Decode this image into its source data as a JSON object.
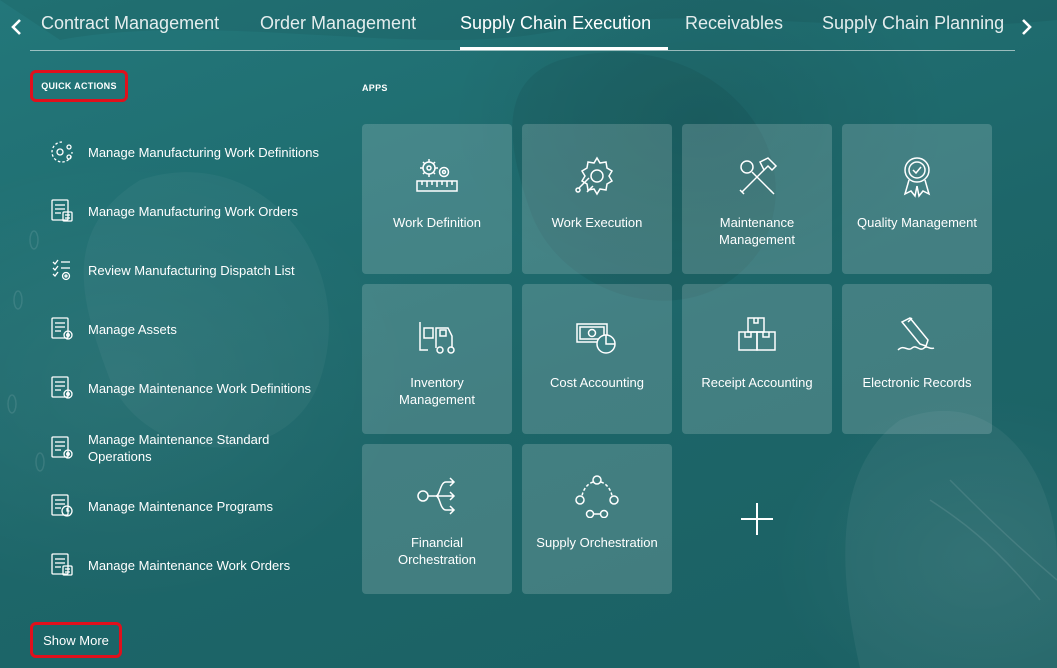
{
  "nav": {
    "tabs": [
      {
        "label": "Contract Management",
        "active": false
      },
      {
        "label": "Order Management",
        "active": false
      },
      {
        "label": "Supply Chain Execution",
        "active": true
      },
      {
        "label": "Receivables",
        "active": false
      },
      {
        "label": "Supply Chain Planning",
        "active": false
      }
    ],
    "left_arrow_icon": "chevron-left-icon",
    "right_arrow_icon": "chevron-right-icon"
  },
  "quick_actions": {
    "heading": "QUICK ACTIONS",
    "items": [
      {
        "label": "Manage Manufacturing Work Definitions",
        "icon": "work-definition-icon"
      },
      {
        "label": "Manage Manufacturing Work Orders",
        "icon": "work-order-icon"
      },
      {
        "label": "Review Manufacturing Dispatch List",
        "icon": "dispatch-list-icon"
      },
      {
        "label": "Manage Assets",
        "icon": "asset-list-icon"
      },
      {
        "label": "Manage Maintenance Work Definitions",
        "icon": "maintenance-definition-icon"
      },
      {
        "label": "Manage Maintenance Standard Operations",
        "icon": "standard-operations-icon"
      },
      {
        "label": "Manage Maintenance Programs",
        "icon": "maintenance-program-icon"
      },
      {
        "label": "Manage Maintenance Work Orders",
        "icon": "maintenance-work-order-icon"
      }
    ],
    "show_more": "Show More"
  },
  "apps": {
    "heading": "APPS",
    "tiles": [
      {
        "label": "Work Definition",
        "icon": "gears-ruler-icon"
      },
      {
        "label": "Work Execution",
        "icon": "gear-wrench-icon"
      },
      {
        "label": "Maintenance Management",
        "icon": "hammer-wrench-icon"
      },
      {
        "label": "Quality Management",
        "icon": "award-ribbon-icon"
      },
      {
        "label": "Inventory Management",
        "icon": "forklift-icon"
      },
      {
        "label": "Cost Accounting",
        "icon": "money-chart-icon"
      },
      {
        "label": "Receipt Accounting",
        "icon": "boxes-icon"
      },
      {
        "label": "Electronic Records",
        "icon": "signature-pen-icon"
      },
      {
        "label": "Financial Orchestration",
        "icon": "flow-arrows-icon"
      },
      {
        "label": "Supply Orchestration",
        "icon": "cycle-nodes-icon"
      }
    ],
    "add_icon": "plus-icon"
  },
  "colors": {
    "background": "#1f6a6e",
    "tile": "rgba(255,255,255,0.17)",
    "highlight": "#e0101c",
    "text": "#ffffff"
  }
}
